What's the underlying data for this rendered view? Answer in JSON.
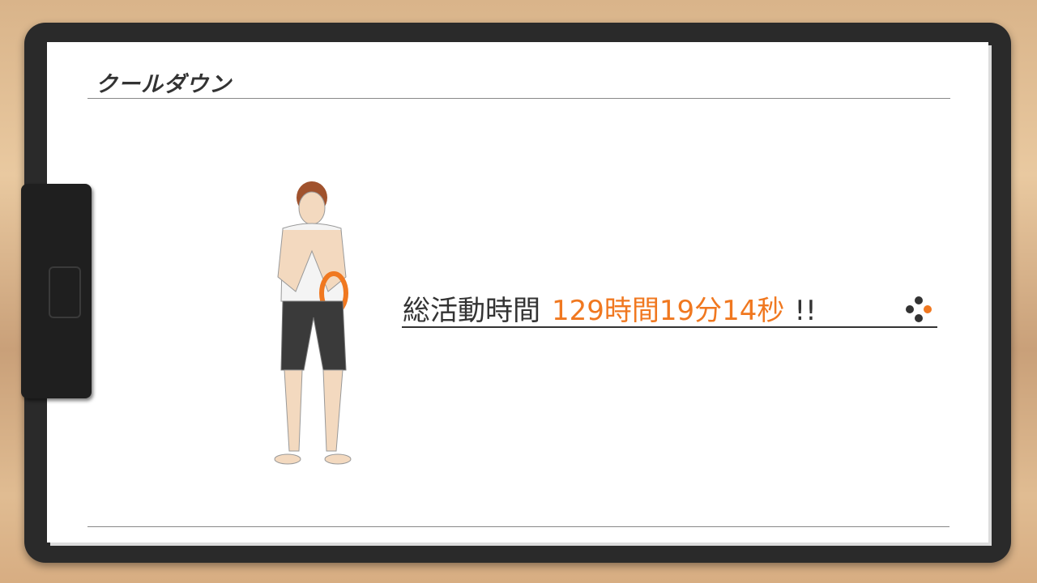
{
  "header": {
    "title": "クールダウン"
  },
  "stat": {
    "label": "総活動時間",
    "value": "129時間19分14秒",
    "suffix": "!!"
  },
  "colors": {
    "accent": "#f07820",
    "text": "#333333"
  },
  "icons": {
    "advance": "a-button-icon"
  }
}
